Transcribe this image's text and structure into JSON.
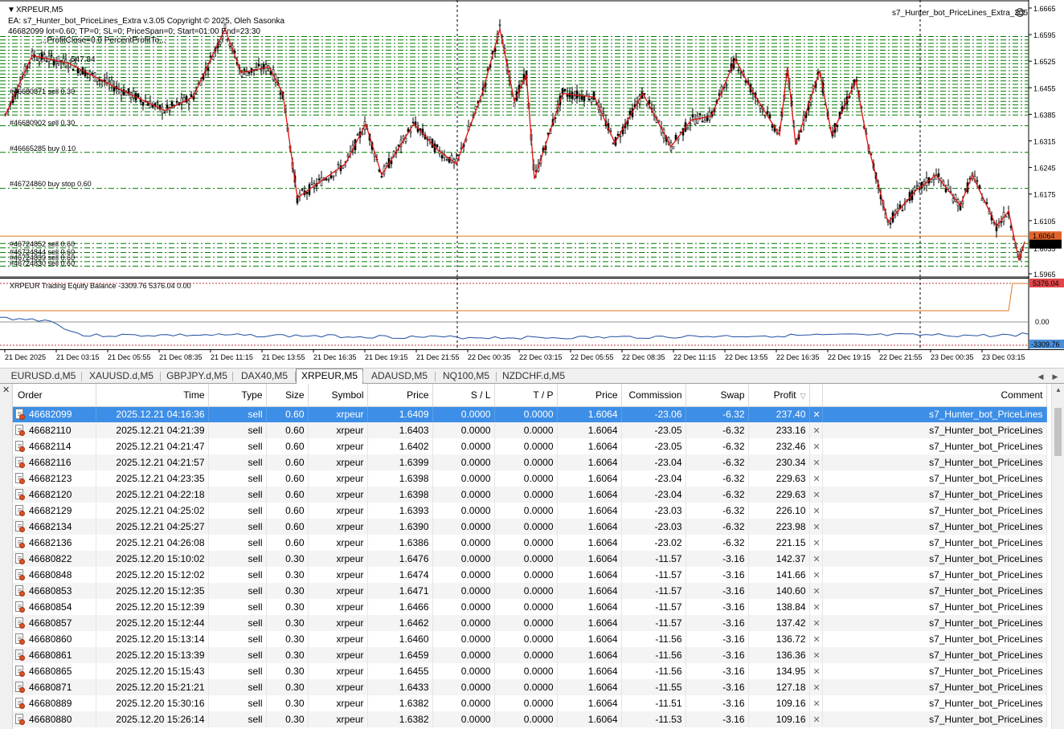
{
  "chart": {
    "symbol_label": "XRPEUR,M5",
    "ea_line": "EA: s7_Hunter_bot_PriceLines_Extra v.3.05 Copyright © 2025, Oleh Sasonka",
    "ea_info": "46682099 lot=0.60; TP=0; SL=0; PriceSpan=0; Start=01:00 End=23:30",
    "corner_label": "s7_Hunter_bot_PriceLines_Extra_305",
    "overlap_text_1": "...ProfitClose=0.0 PercentProfitTo...",
    "overlap_text_2": "547.84",
    "price_ticks": [
      "1.6665",
      "1.6595",
      "1.6525",
      "1.6455",
      "1.6385",
      "1.6315",
      "1.6245",
      "1.6175",
      "1.6105",
      "1.5965"
    ],
    "price_tags": {
      "orange": "1.6064",
      "black": "1.6042",
      "gray": "1.6035"
    },
    "order_labels": [
      "#46680871 sell 0.30",
      "#46680902 sell 0.30",
      "#46665285 buy 0.10",
      "#46724860 buy stop 0.60",
      "#46724852 sell 0.60",
      "#46724844 sell 0.60",
      "#46724839 sell 0.60",
      "#46724830 sell 0.60"
    ],
    "indicator_label": "XRPEUR Trading Equity Balance -3309.76 5376.04 0.00",
    "indicator_ticks": {
      "top": "5376.04",
      "zero": "0.00",
      "bottom": "-3309.76"
    },
    "time_labels": [
      "21 Dec 2025",
      "21 Dec 03:15",
      "21 Dec 05:55",
      "21 Dec 08:35",
      "21 Dec 11:15",
      "21 Dec 13:55",
      "21 Dec 16:35",
      "21 Dec 19:15",
      "21 Dec 21:55",
      "22 Dec 00:35",
      "22 Dec 03:15",
      "22 Dec 05:55",
      "22 Dec 08:35",
      "22 Dec 11:15",
      "22 Dec 13:55",
      "22 Dec 16:35",
      "22 Dec 19:15",
      "22 Dec 21:55",
      "23 Dec 00:35",
      "23 Dec 03:15"
    ],
    "colors": {
      "level_lines": "#007a00",
      "zigzag": "#e01010",
      "bid_line": "#e07820",
      "equity": "#e07820",
      "balance": "#1f4fa0",
      "candles": "#000000"
    }
  },
  "symbol_tabs": [
    {
      "label": "EURUSD.d,M5",
      "active": false
    },
    {
      "label": "XAUUSD.d,M5",
      "active": false
    },
    {
      "label": "GBPJPY.d,M5",
      "active": false
    },
    {
      "label": "DAX40,M5",
      "active": false
    },
    {
      "label": "XRPEUR,M5",
      "active": true
    },
    {
      "label": "ADAUSD,M5",
      "active": false
    },
    {
      "label": "NQ100,M5",
      "active": false
    },
    {
      "label": "NZDCHF.d,M5",
      "active": false
    }
  ],
  "table": {
    "columns": [
      "Order",
      "Time",
      "Type",
      "Size",
      "Symbol",
      "Price",
      "S / L",
      "T / P",
      "Price",
      "Commission",
      "Swap",
      "Profit",
      "",
      "Comment"
    ],
    "selected_row": 0,
    "rows": [
      [
        "46682099",
        "2025.12.21 04:16:36",
        "sell",
        "0.60",
        "xrpeur",
        "1.6409",
        "0.0000",
        "0.0000",
        "1.6064",
        "-23.06",
        "-6.32",
        "237.40",
        "s7_Hunter_bot_PriceLines"
      ],
      [
        "46682110",
        "2025.12.21 04:21:39",
        "sell",
        "0.60",
        "xrpeur",
        "1.6403",
        "0.0000",
        "0.0000",
        "1.6064",
        "-23.05",
        "-6.32",
        "233.16",
        "s7_Hunter_bot_PriceLines"
      ],
      [
        "46682114",
        "2025.12.21 04:21:47",
        "sell",
        "0.60",
        "xrpeur",
        "1.6402",
        "0.0000",
        "0.0000",
        "1.6064",
        "-23.05",
        "-6.32",
        "232.46",
        "s7_Hunter_bot_PriceLines"
      ],
      [
        "46682116",
        "2025.12.21 04:21:57",
        "sell",
        "0.60",
        "xrpeur",
        "1.6399",
        "0.0000",
        "0.0000",
        "1.6064",
        "-23.04",
        "-6.32",
        "230.34",
        "s7_Hunter_bot_PriceLines"
      ],
      [
        "46682123",
        "2025.12.21 04:23:35",
        "sell",
        "0.60",
        "xrpeur",
        "1.6398",
        "0.0000",
        "0.0000",
        "1.6064",
        "-23.04",
        "-6.32",
        "229.63",
        "s7_Hunter_bot_PriceLines"
      ],
      [
        "46682120",
        "2025.12.21 04:22:18",
        "sell",
        "0.60",
        "xrpeur",
        "1.6398",
        "0.0000",
        "0.0000",
        "1.6064",
        "-23.04",
        "-6.32",
        "229.63",
        "s7_Hunter_bot_PriceLines"
      ],
      [
        "46682129",
        "2025.12.21 04:25:02",
        "sell",
        "0.60",
        "xrpeur",
        "1.6393",
        "0.0000",
        "0.0000",
        "1.6064",
        "-23.03",
        "-6.32",
        "226.10",
        "s7_Hunter_bot_PriceLines"
      ],
      [
        "46682134",
        "2025.12.21 04:25:27",
        "sell",
        "0.60",
        "xrpeur",
        "1.6390",
        "0.0000",
        "0.0000",
        "1.6064",
        "-23.03",
        "-6.32",
        "223.98",
        "s7_Hunter_bot_PriceLines"
      ],
      [
        "46682136",
        "2025.12.21 04:26:08",
        "sell",
        "0.60",
        "xrpeur",
        "1.6386",
        "0.0000",
        "0.0000",
        "1.6064",
        "-23.02",
        "-6.32",
        "221.15",
        "s7_Hunter_bot_PriceLines"
      ],
      [
        "46680822",
        "2025.12.20 15:10:02",
        "sell",
        "0.30",
        "xrpeur",
        "1.6476",
        "0.0000",
        "0.0000",
        "1.6064",
        "-11.57",
        "-3.16",
        "142.37",
        "s7_Hunter_bot_PriceLines"
      ],
      [
        "46680848",
        "2025.12.20 15:12:02",
        "sell",
        "0.30",
        "xrpeur",
        "1.6474",
        "0.0000",
        "0.0000",
        "1.6064",
        "-11.57",
        "-3.16",
        "141.66",
        "s7_Hunter_bot_PriceLines"
      ],
      [
        "46680853",
        "2025.12.20 15:12:35",
        "sell",
        "0.30",
        "xrpeur",
        "1.6471",
        "0.0000",
        "0.0000",
        "1.6064",
        "-11.57",
        "-3.16",
        "140.60",
        "s7_Hunter_bot_PriceLines"
      ],
      [
        "46680854",
        "2025.12.20 15:12:39",
        "sell",
        "0.30",
        "xrpeur",
        "1.6466",
        "0.0000",
        "0.0000",
        "1.6064",
        "-11.57",
        "-3.16",
        "138.84",
        "s7_Hunter_bot_PriceLines"
      ],
      [
        "46680857",
        "2025.12.20 15:12:44",
        "sell",
        "0.30",
        "xrpeur",
        "1.6462",
        "0.0000",
        "0.0000",
        "1.6064",
        "-11.57",
        "-3.16",
        "137.42",
        "s7_Hunter_bot_PriceLines"
      ],
      [
        "46680860",
        "2025.12.20 15:13:14",
        "sell",
        "0.30",
        "xrpeur",
        "1.6460",
        "0.0000",
        "0.0000",
        "1.6064",
        "-11.56",
        "-3.16",
        "136.72",
        "s7_Hunter_bot_PriceLines"
      ],
      [
        "46680861",
        "2025.12.20 15:13:39",
        "sell",
        "0.30",
        "xrpeur",
        "1.6459",
        "0.0000",
        "0.0000",
        "1.6064",
        "-11.56",
        "-3.16",
        "136.36",
        "s7_Hunter_bot_PriceLines"
      ],
      [
        "46680865",
        "2025.12.20 15:15:43",
        "sell",
        "0.30",
        "xrpeur",
        "1.6455",
        "0.0000",
        "0.0000",
        "1.6064",
        "-11.56",
        "-3.16",
        "134.95",
        "s7_Hunter_bot_PriceLines"
      ],
      [
        "46680871",
        "2025.12.20 15:21:21",
        "sell",
        "0.30",
        "xrpeur",
        "1.6433",
        "0.0000",
        "0.0000",
        "1.6064",
        "-11.55",
        "-3.16",
        "127.18",
        "s7_Hunter_bot_PriceLines"
      ],
      [
        "46680889",
        "2025.12.20 15:30:16",
        "sell",
        "0.30",
        "xrpeur",
        "1.6382",
        "0.0000",
        "0.0000",
        "1.6064",
        "-11.51",
        "-3.16",
        "109.16",
        "s7_Hunter_bot_PriceLines"
      ],
      [
        "46680880",
        "2025.12.20 15:26:14",
        "sell",
        "0.30",
        "xrpeur",
        "1.6382",
        "0.0000",
        "0.0000",
        "1.6064",
        "-11.53",
        "-3.16",
        "109.16",
        "s7_Hunter_bot_PriceLines"
      ]
    ]
  }
}
